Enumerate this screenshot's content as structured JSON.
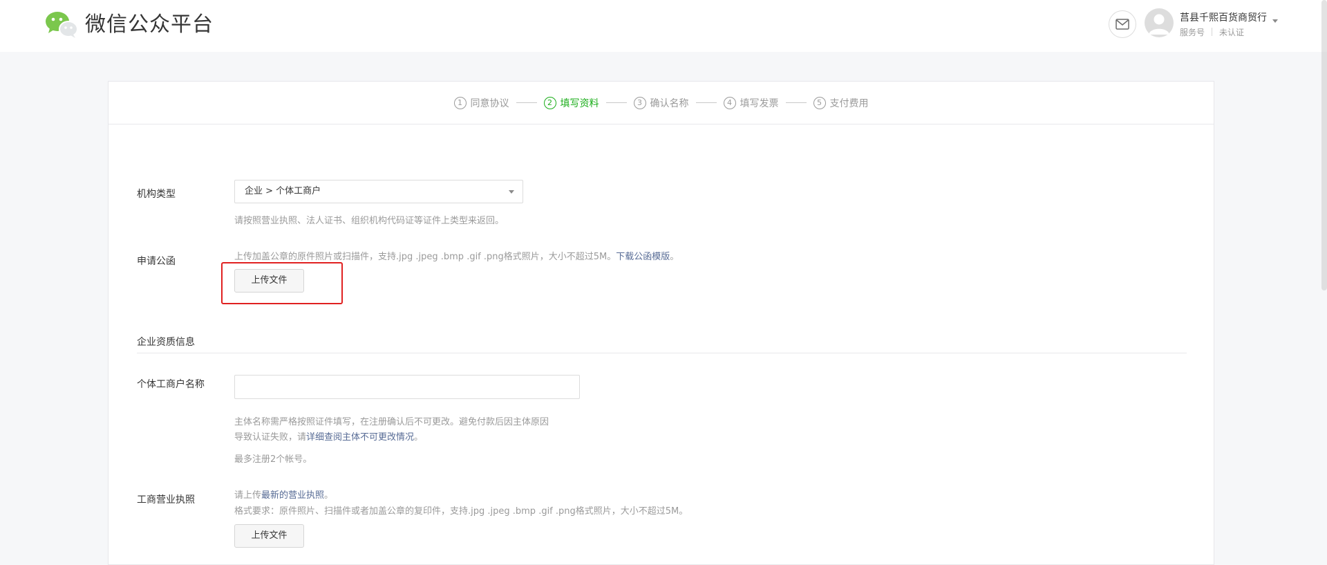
{
  "header": {
    "brand": "微信公众平台",
    "account_name": "莒县千熙百货商贸行",
    "account_type": "服务号",
    "verification": "未认证"
  },
  "steps": [
    {
      "num": "1",
      "label": "同意协议",
      "active": false
    },
    {
      "num": "2",
      "label": "填写资料",
      "active": true
    },
    {
      "num": "3",
      "label": "确认名称",
      "active": false
    },
    {
      "num": "4",
      "label": "填写发票",
      "active": false
    },
    {
      "num": "5",
      "label": "支付费用",
      "active": false
    }
  ],
  "form": {
    "org_type": {
      "label": "机构类型",
      "value": "企业 > 个体工商户",
      "tip": "请按照营业执照、法人证书、组织机构代码证等证件上类型来返回。"
    },
    "letter": {
      "label": "申请公函",
      "tip": "上传加盖公章的原件照片或扫描件，支持.jpg .jpeg .bmp .gif .png格式照片，大小不超过5M。",
      "template_link": "下载公函模版",
      "tip_end": "。",
      "upload_label": "上传文件"
    },
    "qualification_title": "企业资质信息",
    "business_name": {
      "label": "个体工商户名称",
      "value": "",
      "tip_line1": "主体名称需严格按照证件填写，在注册确认后不可更改。避免付款后因主体原因",
      "tip_line2_prefix": "导致认证失败，请",
      "tip_line2_link": "详细查阅主体不可更改情况",
      "tip_line2_end": "。",
      "limit": "最多注册2个帐号。"
    },
    "license": {
      "label": "工商营业执照",
      "tip1_prefix": "请上传",
      "tip1_link": "最新的营业执照",
      "tip1_end": "。",
      "tip2": "格式要求：原件照片、扫描件或者加盖公章的复印件，支持.jpg .jpeg .bmp .gif .png格式照片，大小不超过5M。",
      "upload_label": "上传文件"
    }
  },
  "colors": {
    "accent": "#1aad19",
    "link": "#576b95",
    "highlight": "#e02020"
  }
}
